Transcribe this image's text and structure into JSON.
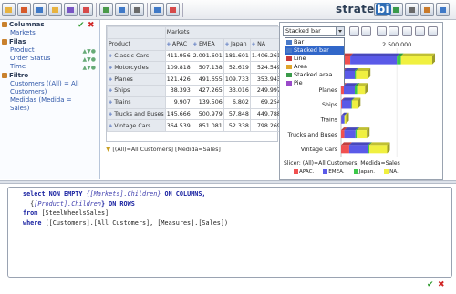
{
  "app": {
    "logo_text": "strate",
    "logo_badge": "bi"
  },
  "toolbar": {
    "icons": [
      "new-icon",
      "open-icon",
      "save-icon",
      "open-folder-icon",
      "drill-icon",
      "swap-axes-icon",
      "hide-empty-icon",
      "mdx-icon",
      "sort-icon",
      "table-icon",
      "chart-icon",
      "pdf-export-icon",
      "excel-export-icon",
      "print-icon",
      "settings-icon",
      "help-icon"
    ]
  },
  "left": {
    "columnas": {
      "title": "Columnas",
      "items": [
        "Markets"
      ]
    },
    "filas": {
      "title": "Filas",
      "items": [
        "Product",
        "Order Status",
        "Time"
      ]
    },
    "filtro": {
      "title": "Filtro",
      "items": [
        "Customers ((All) = All Customers)",
        "Medidas (Medida = Sales)"
      ]
    }
  },
  "grid": {
    "markets_label": "Markets",
    "product_label": "Product",
    "columns": [
      "APAC",
      "EMEA",
      "Japan",
      "NA"
    ],
    "rows": [
      {
        "label": "Classic Cars",
        "values": [
          "411.956",
          "2.091.601",
          "181.601",
          "1.406.261"
        ]
      },
      {
        "label": "Motorcycles",
        "values": [
          "109.818",
          "507.138",
          "52.619",
          "524.549"
        ]
      },
      {
        "label": "Planes",
        "values": [
          "121.426",
          "491.655",
          "109.733",
          "353.943"
        ]
      },
      {
        "label": "Ships",
        "values": [
          "38.393",
          "427.265",
          "33.016",
          "249.997"
        ]
      },
      {
        "label": "Trains",
        "values": [
          "9.907",
          "139.506",
          "6.802",
          "69.254"
        ]
      },
      {
        "label": "Trucks and Buses",
        "values": [
          "145.666",
          "500.979",
          "57.848",
          "449.788"
        ]
      },
      {
        "label": "Vintage Cars",
        "values": [
          "364.539",
          "851.081",
          "52.338",
          "798.269"
        ]
      }
    ],
    "slicer": "[(All)=All Customers] [Medida=Sales]"
  },
  "chart_panel": {
    "selected_type": "Stacked bar",
    "options": [
      {
        "label": "Bar",
        "icon_color": "#4a7ac9"
      },
      {
        "label": "Stacked bar",
        "icon_color": "#4a7ac9"
      },
      {
        "label": "Line",
        "icon_color": "#c93a3a"
      },
      {
        "label": "Area",
        "icon_color": "#e0a52b"
      },
      {
        "label": "Stacked area",
        "icon_color": "#3a9a4a"
      },
      {
        "label": "Pie",
        "icon_color": "#9a4ac9"
      }
    ],
    "tick_label": "2.500.000",
    "slicer": "Slicer: (All)=All Customers, Medida=Sales"
  },
  "chart_data": {
    "type": "bar",
    "orientation": "horizontal",
    "stacked": true,
    "categories": [
      "Classic Cars",
      "Motorcycles",
      "Planes",
      "Ships",
      "Trains",
      "Trucks and Buses",
      "Vintage Cars"
    ],
    "series": [
      {
        "name": "APAC.",
        "color": "#f05050",
        "values": [
          411956,
          109818,
          121426,
          38393,
          9907,
          145666,
          364539
        ]
      },
      {
        "name": "EMEA.",
        "color": "#5a5ae8",
        "values": [
          2091601,
          507138,
          491655,
          427265,
          139506,
          500979,
          851081
        ]
      },
      {
        "name": "Japan.",
        "color": "#3cc84a",
        "values": [
          181601,
          52619,
          109733,
          33016,
          6802,
          57848,
          52338
        ]
      },
      {
        "name": "NA.",
        "color": "#f0f040",
        "values": [
          1406261,
          524549,
          353943,
          249997,
          69254,
          449788,
          798269
        ]
      }
    ],
    "ticks": [
      "2.500.000"
    ],
    "xlim": [
      0,
      4500000
    ]
  },
  "mdx": {
    "line1a": "select NON EMPTY ",
    "line1b": "{[Markets].Children}",
    "line1c": " ON COLUMNS,",
    "line2a": "  {",
    "line2b": "[Product].Children",
    "line2c": "} ON ROWS",
    "line3a": "from ",
    "line3b": "[SteelWheelsSales]",
    "line4a": "where ",
    "line4b": "([Customers].[All Customers], [Measures].[Sales])"
  }
}
